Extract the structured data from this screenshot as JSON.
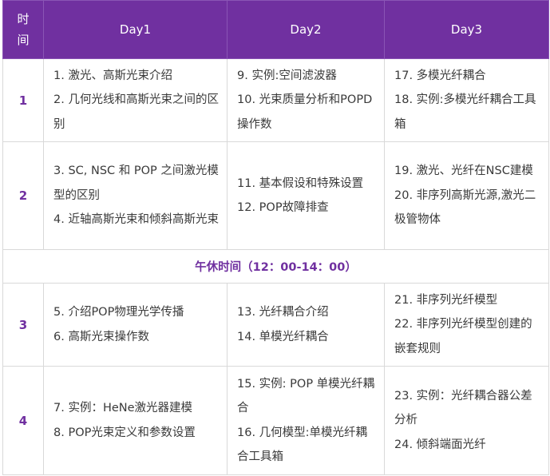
{
  "header": {
    "time": [
      "时",
      "间"
    ],
    "days": [
      "Day1",
      "Day2",
      "Day3"
    ]
  },
  "rows": [
    {
      "num": "1",
      "cells": [
        [
          "1. 激光、高斯光束介绍",
          "2. 几何光线和高斯光束之间的区别"
        ],
        [
          "9. 实例:空间滤波器",
          "10. 光束质量分析和POPD操作数"
        ],
        [
          "17. 多模光纤耦合",
          "18. 实例:多模光纤耦合工具箱"
        ]
      ]
    },
    {
      "num": "2",
      "cells": [
        [
          "3. SC, NSC 和 POP 之间激光模型的区别",
          "4. 近轴高斯光束和倾斜高斯光束"
        ],
        [
          "11. 基本假设和特殊设置",
          "12. POP故障排查"
        ],
        [
          "19. 激光、光纤在NSC建模",
          "20. 非序列高斯光源,激光二极管物体"
        ]
      ]
    },
    {
      "lunch": "午休时间（12：00-14：00）"
    },
    {
      "num": "3",
      "cells": [
        [
          "5. 介绍POP物理光学传播",
          "6. 高斯光束操作数"
        ],
        [
          "13. 光纤耦合介绍",
          "14. 单模光纤耦合"
        ],
        [
          "21. 非序列光纤模型",
          "22. 非序列光纤模型创建的嵌套规则"
        ]
      ]
    },
    {
      "num": "4",
      "cells": [
        [
          "7. 实例：HeNe激光器建模",
          "8. POP光束定义和参数设置"
        ],
        [
          "15. 实例: POP 单模光纤耦合",
          "16. 几何模型:单模光纤耦合工具箱"
        ],
        [
          "23. 实例：光纤耦合器公差分析",
          "24. 倾斜端面光纤"
        ]
      ]
    }
  ]
}
